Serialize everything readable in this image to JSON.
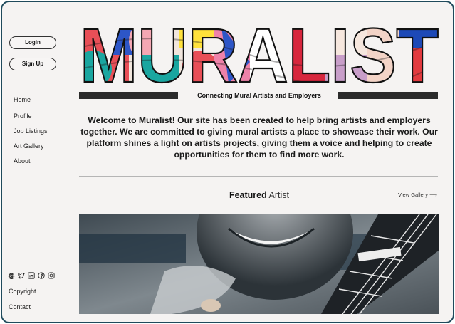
{
  "auth": {
    "login_label": "Login",
    "signup_label": "Sign Up"
  },
  "nav": {
    "items": [
      "Home",
      "Profile",
      "Job Listings",
      "Art Gallery",
      "About"
    ]
  },
  "social": {
    "icons": [
      "google-icon",
      "twitter-icon",
      "linkedin-icon",
      "facebook-icon",
      "instagram-icon"
    ]
  },
  "footer": {
    "copyright": "Copyright",
    "contact": "Contact"
  },
  "logo": {
    "text": "MURALIST"
  },
  "tagline": "Connecting Mural Artists and Employers",
  "welcome": "Welcome to Muralist! Our site has been created to help bring artists and employers together. We are committed to giving mural artists a place to showcase their work. Our platform shines a light on artists projects, giving them a voice and helping to create opportunities for them to find more work.",
  "featured": {
    "bold": "Featured",
    "light": "Artist",
    "view_gallery": "View Gallery",
    "arrow": "⟶"
  },
  "colors": {
    "border": "#1f4a5c",
    "background": "#f5f3f2",
    "bars": "#2b2b2b"
  }
}
